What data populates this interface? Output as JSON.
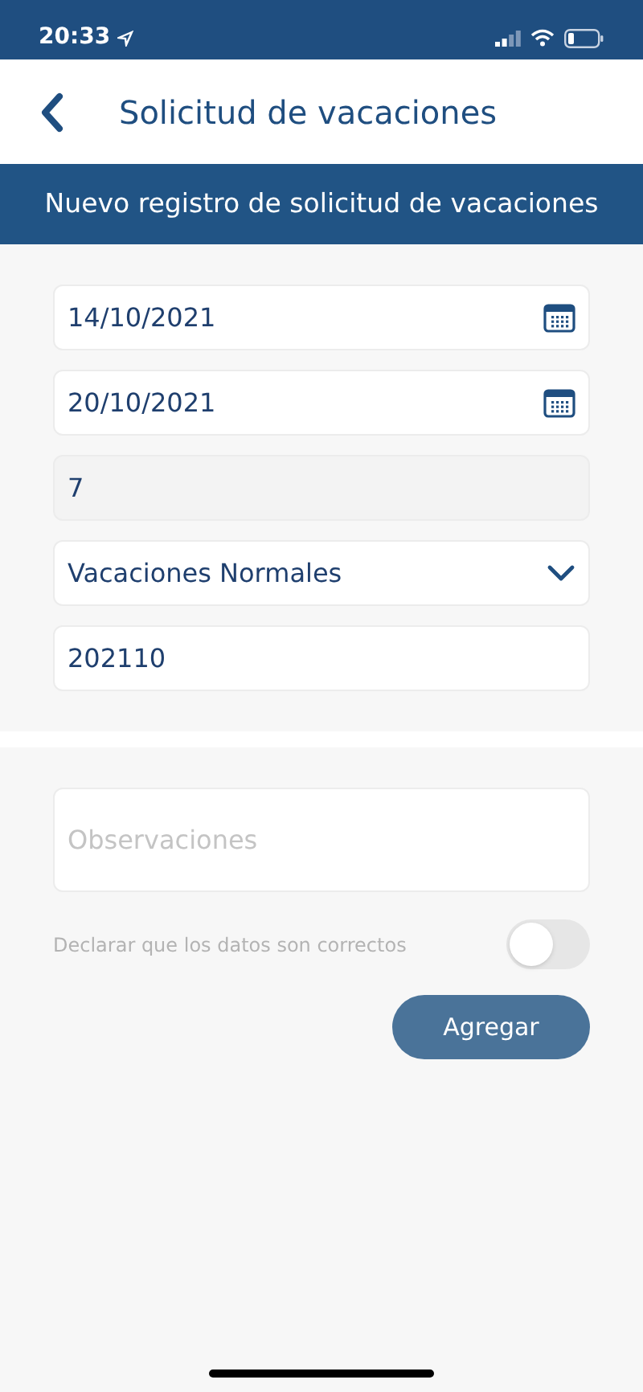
{
  "status_bar": {
    "time": "20:33"
  },
  "header": {
    "title": "Solicitud de vacaciones"
  },
  "banner": {
    "title": "Nuevo registro de solicitud de vacaciones"
  },
  "fields": [
    {
      "kind": "date",
      "value": "14/10/2021"
    },
    {
      "kind": "date",
      "value": "20/10/2021"
    },
    {
      "kind": "readonly",
      "value": "7"
    },
    {
      "kind": "select",
      "value": "Vacaciones Normales"
    },
    {
      "kind": "text",
      "value": "202110"
    }
  ],
  "observations": {
    "placeholder": "Observaciones"
  },
  "declaration": {
    "label": "Declarar que los datos son correctos",
    "on": false
  },
  "submit": {
    "label": "Agregar"
  }
}
